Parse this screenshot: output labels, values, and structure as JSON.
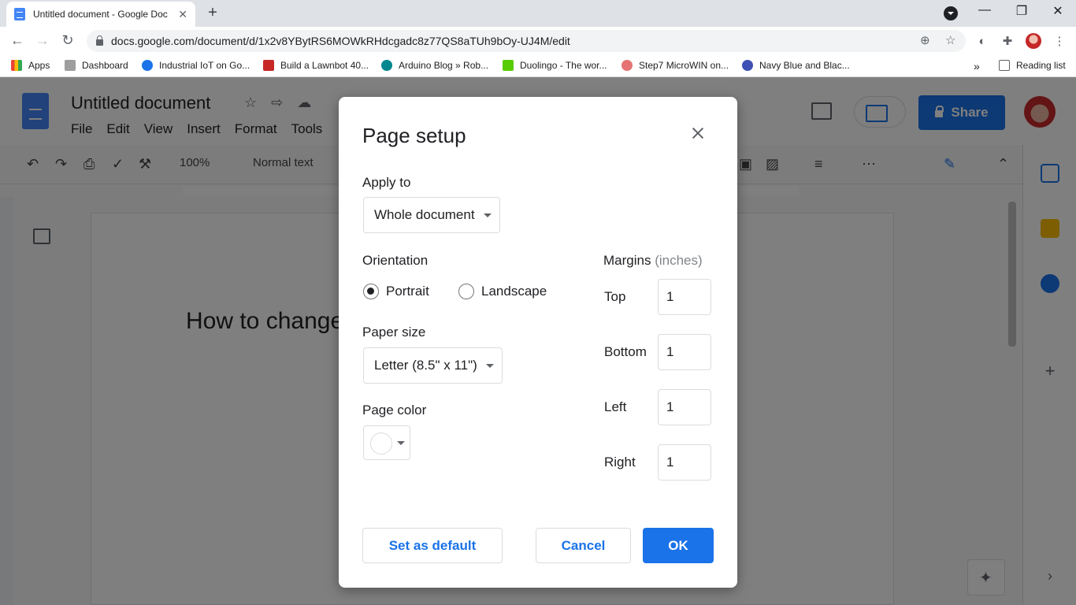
{
  "browser": {
    "tab_title": "Untitled document - Google Doc",
    "url": "docs.google.com/document/d/1x2v8YBytRS6MOWkRHdcgadc8z77QS8aTUh9bOy-UJ4M/edit",
    "bookmarks": [
      "Apps",
      "Dashboard",
      "Industrial IoT on Go...",
      "Build a Lawnbot 40...",
      "Arduino Blog » Rob...",
      "Duolingo - The wor...",
      "Step7 MicroWIN on...",
      "Navy Blue and Blac..."
    ],
    "more_bookmarks": "»",
    "reading_list": "Reading list"
  },
  "docs": {
    "title": "Untitled document",
    "menu": [
      "File",
      "Edit",
      "View",
      "Insert",
      "Format",
      "Tools"
    ],
    "share_label": "Share",
    "zoom": "100%",
    "style": "Normal text",
    "page_text": "How to change"
  },
  "dialog": {
    "title": "Page setup",
    "apply_to_label": "Apply to",
    "apply_to_value": "Whole document",
    "orientation_label": "Orientation",
    "portrait_label": "Portrait",
    "landscape_label": "Landscape",
    "orientation_selected": "Portrait",
    "paper_size_label": "Paper size",
    "paper_size_value": "Letter (8.5\" x 11\")",
    "page_color_label": "Page color",
    "page_color_value": "#ffffff",
    "margins_label": "Margins",
    "margins_unit": "(inches)",
    "margins": {
      "top_label": "Top",
      "top": "1",
      "bottom_label": "Bottom",
      "bottom": "1",
      "left_label": "Left",
      "left": "1",
      "right_label": "Right",
      "right": "1"
    },
    "set_default_label": "Set as default",
    "cancel_label": "Cancel",
    "ok_label": "OK"
  },
  "colors": {
    "accent": "#1a73e8"
  }
}
